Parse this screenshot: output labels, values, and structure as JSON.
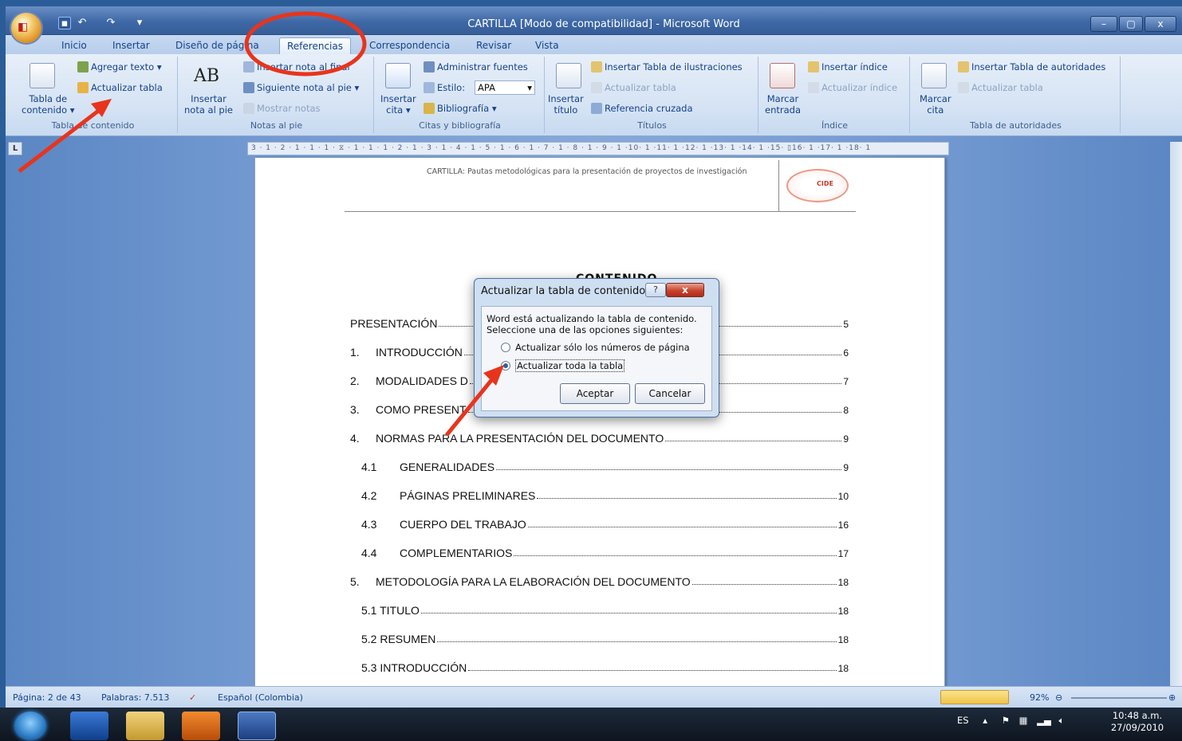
{
  "window": {
    "title": "CARTILLA [Modo de compatibilidad] - Microsoft Word",
    "minimize": "–",
    "maximize": "▢",
    "close": "x"
  },
  "tabs": [
    "Inicio",
    "Insertar",
    "Diseño de página",
    "Referencias",
    "Correspondencia",
    "Revisar",
    "Vista"
  ],
  "ribbon": {
    "toc_group": {
      "label": "Tabla de contenido",
      "tabla_btn": "Tabla de",
      "tabla_btn2": "contenido",
      "agregar": "Agregar texto",
      "actualizar": "Actualizar tabla"
    },
    "notes_group": {
      "label": "Notas al pie",
      "insertar1": "Insertar",
      "insertar2": "nota al pie",
      "nota_final": "Insertar nota al final",
      "siguiente": "Siguiente nota al pie",
      "mostrar": "Mostrar notas",
      "glyph": "AB"
    },
    "cite_group": {
      "label": "Citas y bibliografía",
      "insertar1": "Insertar",
      "insertar2": "cita",
      "administrar": "Administrar fuentes",
      "estilo": "Estilo:",
      "estilo_val": "APA",
      "bibliografia": "Bibliografía"
    },
    "titles_group": {
      "label": "Títulos",
      "insertar1": "Insertar",
      "insertar2": "título",
      "tabla_ilus": "Insertar Tabla de ilustraciones",
      "actualizar": "Actualizar tabla",
      "ref_cruzada": "Referencia cruzada"
    },
    "index_group": {
      "label": "Índice",
      "marcar1": "Marcar",
      "marcar2": "entrada",
      "insertar": "Insertar índice",
      "actualizar": "Actualizar índice"
    },
    "auth_group": {
      "label": "Tabla de autoridades",
      "marcar1": "Marcar",
      "marcar2": "cita",
      "insertar": "Insertar Tabla de autoridades",
      "actualizar": "Actualizar tabla"
    }
  },
  "ruler": "3 · 1 · 2 · 1 · 1 · 1 · ⧖ · 1 · 1 · 1 · 2 · 1 · 3 · 1 · 4 · 1 · 5 · 1 · 6 · 1 · 7 · 1 · 8 · 1 · 9 · 1 ·10· 1 ·11· 1 ·12· 1 ·13· 1 ·14· 1 ·15· ▯16· 1 ·17· 1 ·18· 1",
  "ruler_corner": "L",
  "document": {
    "header": "CARTILLA: Pautas metodológicas para la presentación de proyectos de investigación",
    "logo": "CIDE",
    "toc_title": "CONTENIDO",
    "toc": [
      {
        "num": "",
        "label": "PRESENTACIÓN",
        "page": "5"
      },
      {
        "num": "1.",
        "label": "INTRODUCCIÓN",
        "page": "6"
      },
      {
        "num": "2.",
        "label": "MODALIDADES D",
        "page": "7"
      },
      {
        "num": "3.",
        "label": "COMO PRESENT",
        "page": "8"
      },
      {
        "num": "4.",
        "label": "NORMAS PARA LA PRESENTACIÓN DEL DOCUMENTO",
        "page": "9"
      },
      {
        "num": "4.1",
        "label": "GENERALIDADES",
        "page": "9"
      },
      {
        "num": "4.2",
        "label": "PÁGINAS PRELIMINARES",
        "page": "10"
      },
      {
        "num": "4.3",
        "label": "CUERPO DEL TRABAJO",
        "page": "16"
      },
      {
        "num": "4.4",
        "label": "COMPLEMENTARIOS",
        "page": "17"
      },
      {
        "num": "5.",
        "label": "METODOLOGÍA PARA LA ELABORACIÓN DEL DOCUMENTO",
        "page": "18"
      },
      {
        "num": "",
        "label": "5.1 TITULO",
        "page": "18"
      },
      {
        "num": "",
        "label": "5.2 RESUMEN",
        "page": "18"
      },
      {
        "num": "",
        "label": "5.3 INTRODUCCIÓN",
        "page": "18"
      }
    ]
  },
  "dialog": {
    "title": "Actualizar la tabla de contenido",
    "help": "?",
    "close": "x",
    "msg1": "Word está actualizando la tabla de contenido.",
    "msg2": "Seleccione una de las opciones siguientes:",
    "option1": "Actualizar sólo los números de página",
    "option2": "Actualizar toda la tabla",
    "ok": "Aceptar",
    "cancel": "Cancelar"
  },
  "status": {
    "page": "Página: 2 de 43",
    "words": "Palabras: 7.513",
    "lang": "Español (Colombia)",
    "zoom": "92%"
  },
  "taskbar": {
    "lang": "ES",
    "time": "10:48 a.m.",
    "date": "27/09/2010"
  },
  "colors": {
    "accent": "#15428b",
    "annotation": "#e8341c"
  }
}
